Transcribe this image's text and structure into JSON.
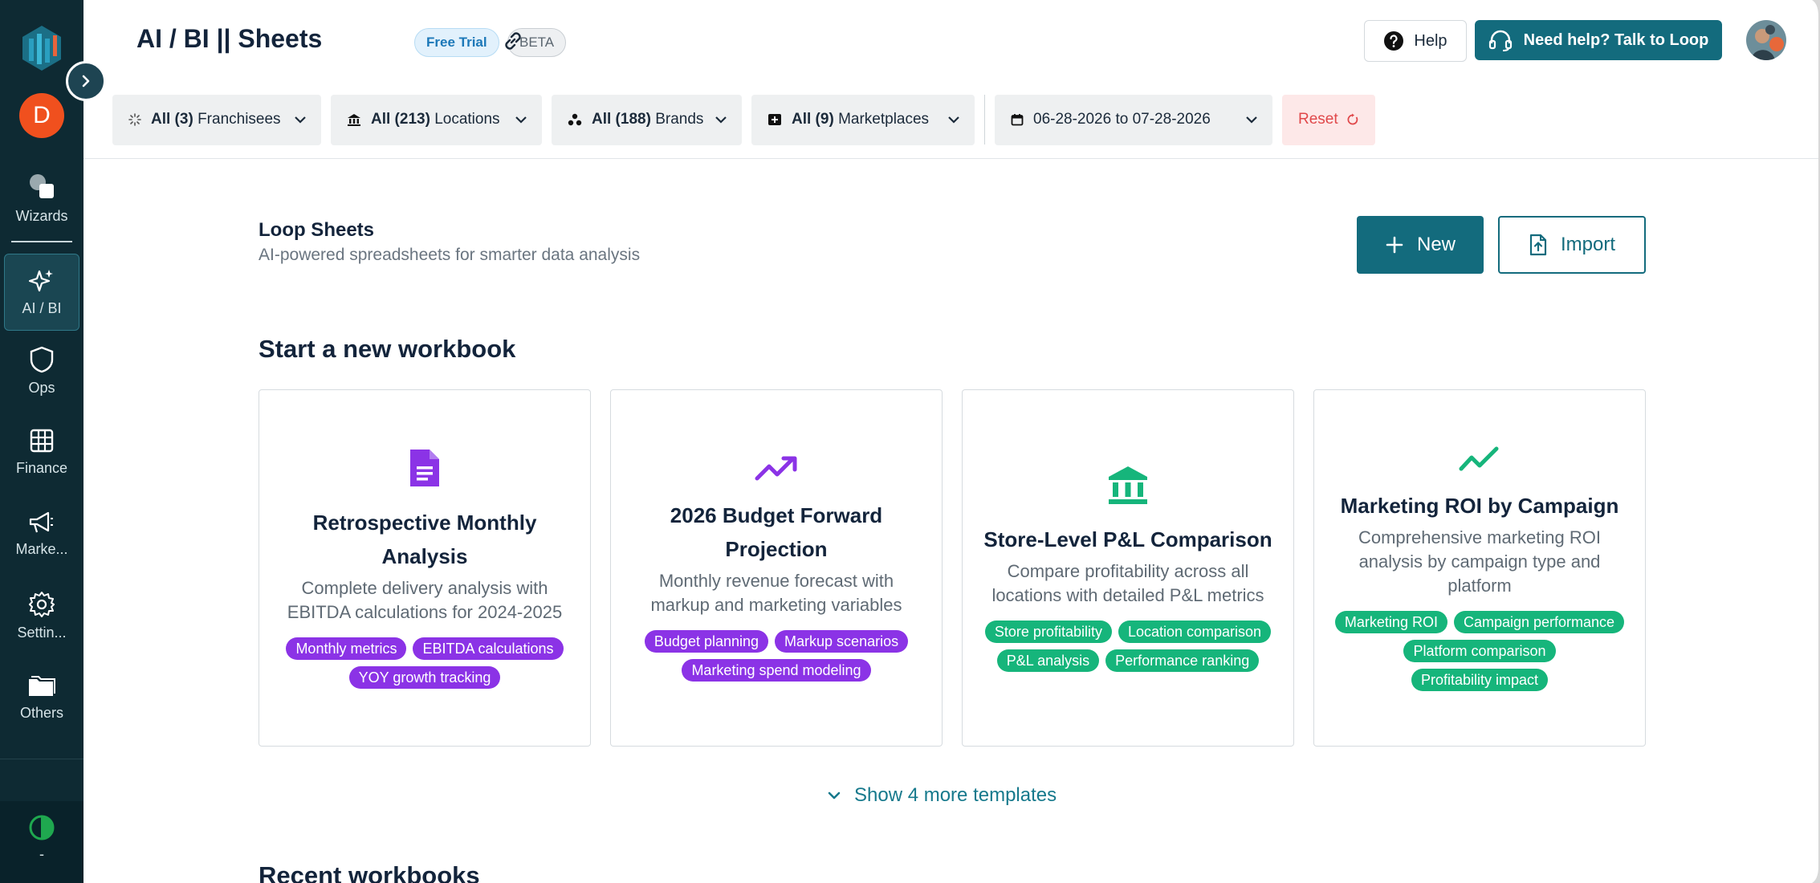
{
  "app": {
    "title": "AI / BI || Sheets",
    "badge_trial": "Free Trial",
    "badge_beta": "BETA"
  },
  "header": {
    "help_label": "Help",
    "talk_label": "Need help? Talk to Loop"
  },
  "sidebar": {
    "user_initial": "D",
    "items": [
      {
        "label": "Wizards",
        "icon": "wizards-icon"
      },
      {
        "label": "AI / BI",
        "icon": "sparkle-icon",
        "active": true
      },
      {
        "label": "Ops",
        "icon": "shield-icon"
      },
      {
        "label": "Finance",
        "icon": "grid-icon"
      },
      {
        "label": "Marke...",
        "icon": "megaphone-icon"
      },
      {
        "label": "Settin...",
        "icon": "gear-icon"
      },
      {
        "label": "Others",
        "icon": "folder-icon"
      }
    ],
    "bottom_label": "-"
  },
  "filters": {
    "franchisees": {
      "bold": "All (3)",
      "label": "Franchisees"
    },
    "locations": {
      "bold": "All (213)",
      "label": "Locations"
    },
    "brands": {
      "bold": "All (188)",
      "label": "Brands"
    },
    "marketplaces": {
      "bold": "All (9)",
      "label": "Marketplaces"
    },
    "date_range": "06-28-2026 to 07-28-2026",
    "reset_label": "Reset"
  },
  "main": {
    "title": "Loop Sheets",
    "subtitle": "AI-powered spreadsheets for smarter data analysis",
    "new_label": "New",
    "import_label": "Import",
    "start_title": "Start a new workbook",
    "more_templates": "Show 4 more templates",
    "recent_title": "Recent workbooks"
  },
  "templates": [
    {
      "title": "Retrospective Monthly Analysis",
      "description": "Complete delivery analysis with EBITDA calculations for 2024-2025",
      "tags": [
        "Monthly metrics",
        "EBITDA calculations",
        "YOY growth tracking"
      ],
      "color": "#8b33e6"
    },
    {
      "title": "2026 Budget Forward Projection",
      "description": "Monthly revenue forecast with markup and marketing variables",
      "tags": [
        "Budget planning",
        "Markup scenarios",
        "Marketing spend modeling"
      ],
      "color": "#8b33e6"
    },
    {
      "title": "Store-Level P&L Comparison",
      "description": "Compare profitability across all locations with detailed P&L metrics",
      "tags": [
        "Store profitability",
        "Location comparison",
        "P&L analysis",
        "Performance ranking"
      ],
      "color": "#16b57b"
    },
    {
      "title": "Marketing ROI by Campaign",
      "description": "Comprehensive marketing ROI analysis by campaign type and platform",
      "tags": [
        "Marketing ROI",
        "Campaign performance",
        "Platform comparison",
        "Profitability impact"
      ],
      "color": "#16b57b"
    }
  ]
}
